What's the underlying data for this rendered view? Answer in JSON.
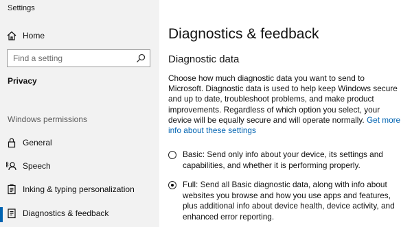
{
  "window": {
    "title": "Settings"
  },
  "sidebar": {
    "home_label": "Home",
    "search_placeholder": "Find a setting",
    "section_title": "Privacy",
    "group_header": "Windows permissions",
    "items": [
      {
        "label": "General",
        "icon": "lock-icon"
      },
      {
        "label": "Speech",
        "icon": "speech-icon"
      },
      {
        "label": "Inking & typing personalization",
        "icon": "clipboard-icon"
      },
      {
        "label": "Diagnostics & feedback",
        "icon": "feedback-icon",
        "active": true
      }
    ]
  },
  "main": {
    "page_title": "Diagnostics & feedback",
    "section_title": "Diagnostic data",
    "description": "Choose how much diagnostic data you want to send to Microsoft. Diagnostic data is used to help keep Windows secure and up to date, troubleshoot problems, and make product improvements. Regardless of which option you select, your device will be equally secure and will operate normally.",
    "more_info_link": "Get more info about these settings",
    "options": [
      {
        "label": "Basic: Send only info about your device, its settings and capabilities, and whether it is performing properly.",
        "selected": false
      },
      {
        "label": "Full: Send all Basic diagnostic data, along with info about websites you browse and how you use apps and features, plus additional info about device health, device activity, and enhanced error reporting.",
        "selected": true
      }
    ]
  },
  "colors": {
    "sidebar_bg": "#f2f2f2",
    "accent": "#0063b1",
    "link": "#0063b1"
  }
}
